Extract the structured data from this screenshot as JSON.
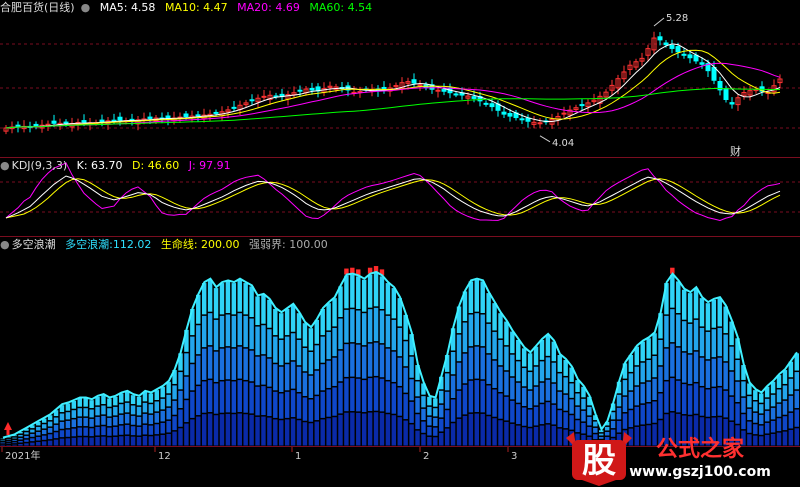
{
  "colors": {
    "ma5": "#ffffff",
    "ma10": "#ffff00",
    "ma20": "#ff00ff",
    "ma60": "#00ff00",
    "up": "#ff3333",
    "down": "#00ffff",
    "grid": "#7a0d1f",
    "wave_top": "#2fe0ff",
    "wave_bot": "#0033aa"
  },
  "main_panel": {
    "title": "合肥百货(日线)",
    "ma5_label": "MA5:",
    "ma5_value": "4.58",
    "ma10_label": "MA10:",
    "ma10_value": "4.47",
    "ma20_label": "MA20:",
    "ma20_value": "4.69",
    "ma60_label": "MA60:",
    "ma60_value": "4.54",
    "high_marker": "5.28",
    "low_marker": "4.04",
    "badge": "财"
  },
  "kdj_panel": {
    "title": "KDJ(9,3,3)",
    "k_label": "K:",
    "k_value": "63.70",
    "d_label": "D:",
    "d_value": "46.60",
    "j_label": "J:",
    "j_value": "97.91"
  },
  "wave_panel": {
    "title": "多空浪潮",
    "series_label": "多空浪潮:",
    "series_value": "112.02",
    "life_label": "生命线:",
    "life_value": "200.00",
    "strong_label": "强弱界:",
    "strong_value": "100.00"
  },
  "x_axis": {
    "labels": [
      "2021年",
      "12",
      "1",
      "2",
      "3"
    ]
  },
  "watermark": {
    "logo_char": "股",
    "name": "公式之家",
    "url": "www.gszj100.com"
  },
  "chart_data": [
    {
      "type": "candlestick",
      "title": "合肥百货(日线)",
      "y_range": [
        3.95,
        5.35
      ],
      "series": [
        {
          "name": "MA5",
          "value": 4.58
        },
        {
          "name": "MA10",
          "value": 4.47
        },
        {
          "name": "MA20",
          "value": 4.69
        },
        {
          "name": "MA60",
          "value": 4.54
        }
      ],
      "annotations": [
        {
          "text": "5.28",
          "type": "period_high"
        },
        {
          "text": "4.04",
          "type": "period_low"
        }
      ],
      "close_trace": [
        4.23,
        4.25,
        4.24,
        4.26,
        4.28,
        4.27,
        4.29,
        4.28,
        4.3,
        4.31,
        4.3,
        4.32,
        4.33,
        4.32,
        4.34,
        4.35,
        4.36,
        4.38,
        4.42,
        4.47,
        4.52,
        4.56,
        4.54,
        4.58,
        4.62,
        4.6,
        4.65,
        4.63,
        4.58,
        4.62,
        4.6,
        4.64,
        4.7,
        4.67,
        4.62,
        4.6,
        4.57,
        4.55,
        4.5,
        4.44,
        4.36,
        4.33,
        4.29,
        4.28,
        4.33,
        4.4,
        4.45,
        4.5,
        4.58,
        4.72,
        4.86,
        4.93,
        5.15,
        5.05,
        4.98,
        4.92,
        4.85,
        4.65,
        4.45,
        4.58,
        4.62,
        4.58,
        4.72
      ]
    },
    {
      "type": "line",
      "title": "KDJ(9,3,3)",
      "y_range": [
        0,
        100
      ],
      "series": [
        {
          "name": "K",
          "last": 63.7
        },
        {
          "name": "D",
          "last": 46.6
        },
        {
          "name": "J",
          "last": 97.91
        }
      ],
      "k_trace": [
        22,
        30,
        40,
        58,
        75,
        88,
        80,
        68,
        55,
        50,
        56,
        62,
        58,
        45,
        38,
        34,
        40,
        48,
        56,
        66,
        74,
        80,
        76,
        68,
        56,
        42,
        34,
        36,
        44,
        52,
        60,
        66,
        72,
        78,
        84,
        80,
        70,
        56,
        44,
        34,
        28,
        24,
        30,
        40,
        50,
        56,
        52,
        46,
        40,
        46,
        56,
        66,
        76,
        86,
        82,
        72,
        60,
        48,
        38,
        30,
        28,
        34,
        45,
        56,
        63.7
      ]
    },
    {
      "type": "bar",
      "title": "多空浪潮",
      "y_range": [
        0,
        220
      ],
      "series": [
        {
          "name": "多空浪潮",
          "last": 112.02
        },
        {
          "name": "生命线",
          "value": 200.0
        },
        {
          "name": "强弱界",
          "value": 100.0
        }
      ],
      "values": [
        10,
        12,
        14,
        18,
        22,
        26,
        30,
        34,
        38,
        44,
        50,
        52,
        55,
        58,
        58,
        56,
        60,
        62,
        58,
        60,
        64,
        66,
        62,
        60,
        66,
        64,
        68,
        72,
        78,
        92,
        112,
        140,
        165,
        182,
        196,
        200,
        190,
        196,
        198,
        196,
        200,
        196,
        192,
        180,
        182,
        176,
        165,
        160,
        165,
        170,
        160,
        148,
        142,
        152,
        165,
        172,
        178,
        192,
        205,
        206,
        204,
        200,
        206,
        208,
        204,
        196,
        190,
        178,
        158,
        135,
        98,
        76,
        60,
        58,
        84,
        110,
        142,
        168,
        186,
        198,
        200,
        198,
        184,
        172,
        160,
        150,
        138,
        128,
        118,
        112,
        120,
        128,
        134,
        126,
        110,
        104,
        95,
        80,
        72,
        60,
        38,
        20,
        30,
        52,
        78,
        100,
        110,
        120,
        126,
        130,
        136,
        160,
        196,
        206,
        198,
        188,
        184,
        190,
        178,
        172,
        176,
        178,
        168,
        150,
        130,
        98,
        76,
        68,
        64,
        72,
        78,
        86,
        92,
        102,
        112
      ]
    }
  ]
}
